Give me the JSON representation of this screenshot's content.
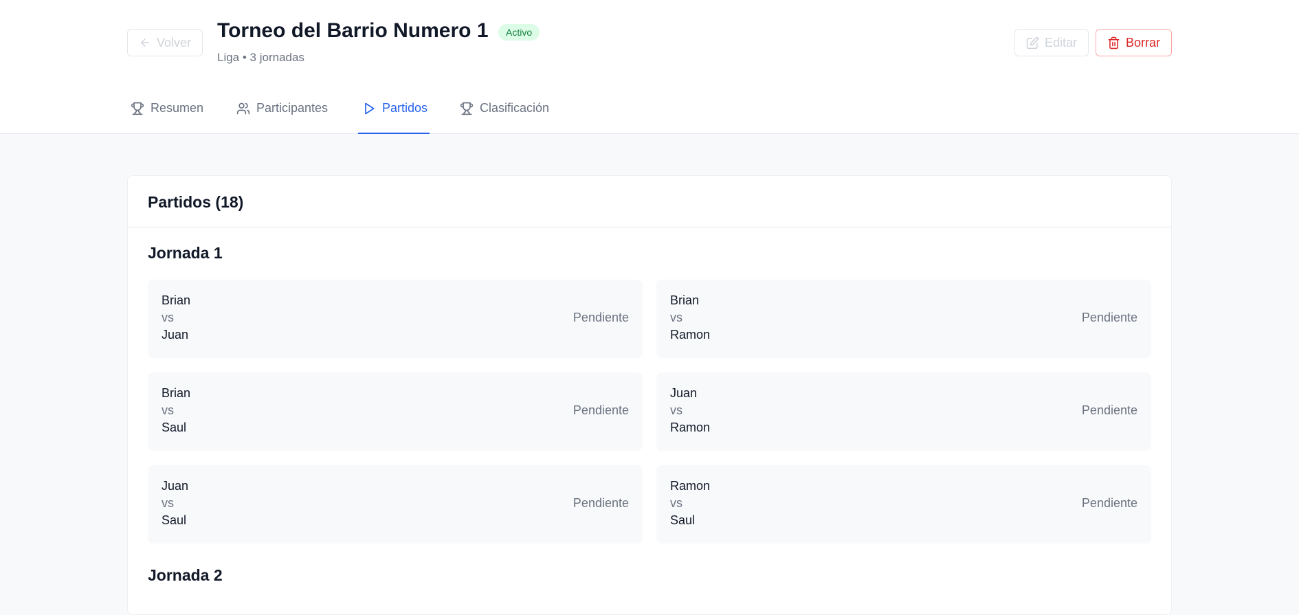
{
  "header": {
    "back_label": "Volver",
    "title": "Torneo del Barrio Numero 1",
    "status_badge": "Activo",
    "subtitle": "Liga • 3 jornadas",
    "edit_label": "Editar",
    "delete_label": "Borrar"
  },
  "tabs": [
    {
      "label": "Resumen",
      "icon": "trophy-icon"
    },
    {
      "label": "Participantes",
      "icon": "users-icon"
    },
    {
      "label": "Partidos",
      "icon": "play-icon",
      "active": true
    },
    {
      "label": "Clasificación",
      "icon": "trophy-icon"
    }
  ],
  "matches_card": {
    "title": "Partidos (18)",
    "rounds": [
      {
        "title": "Jornada 1",
        "matches": [
          {
            "home": "Brian",
            "vs": "vs",
            "away": "Juan",
            "status": "Pendiente"
          },
          {
            "home": "Brian",
            "vs": "vs",
            "away": "Ramon",
            "status": "Pendiente"
          },
          {
            "home": "Brian",
            "vs": "vs",
            "away": "Saul",
            "status": "Pendiente"
          },
          {
            "home": "Juan",
            "vs": "vs",
            "away": "Ramon",
            "status": "Pendiente"
          },
          {
            "home": "Juan",
            "vs": "vs",
            "away": "Saul",
            "status": "Pendiente"
          },
          {
            "home": "Ramon",
            "vs": "vs",
            "away": "Saul",
            "status": "Pendiente"
          }
        ]
      },
      {
        "title": "Jornada 2",
        "matches": []
      }
    ]
  },
  "colors": {
    "accent": "#2563eb",
    "danger": "#dc2626",
    "badge_bg": "#dcfce7",
    "badge_text": "#15803d"
  }
}
